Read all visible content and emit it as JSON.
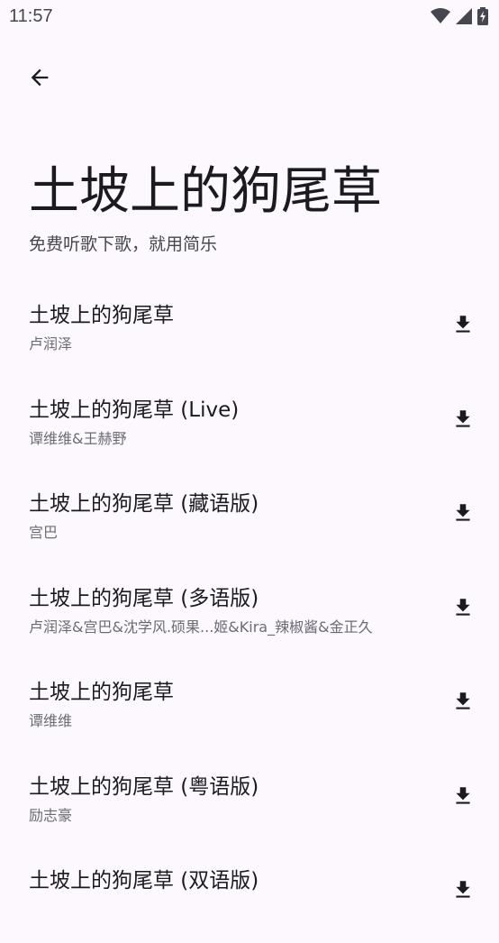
{
  "status_bar": {
    "time": "11:57"
  },
  "header": {
    "title": "土坡上的狗尾草",
    "subtitle": "免费听歌下歌，就用简乐"
  },
  "songs": [
    {
      "title": "土坡上的狗尾草",
      "artist": "卢润泽"
    },
    {
      "title": "土坡上的狗尾草 (Live)",
      "artist": "谭维维&王赫野"
    },
    {
      "title": "土坡上的狗尾草 (藏语版)",
      "artist": "宫巴"
    },
    {
      "title": "土坡上的狗尾草 (多语版)",
      "artist": "卢润泽&宫巴&沈学风.硕果...姬&Kira_辣椒酱&金正久"
    },
    {
      "title": "土坡上的狗尾草",
      "artist": "谭维维"
    },
    {
      "title": "土坡上的狗尾草 (粤语版)",
      "artist": "励志豪"
    },
    {
      "title": "土坡上的狗尾草 (双语版)",
      "artist": ""
    }
  ],
  "icons": {
    "back": "arrow-back-icon",
    "download": "download-icon",
    "wifi": "wifi-icon",
    "signal": "signal-icon",
    "battery": "battery-charging-icon"
  },
  "colors": {
    "background": "#fcf8fd",
    "text_primary": "#1b1b1f",
    "text_secondary": "#6b6b74"
  }
}
